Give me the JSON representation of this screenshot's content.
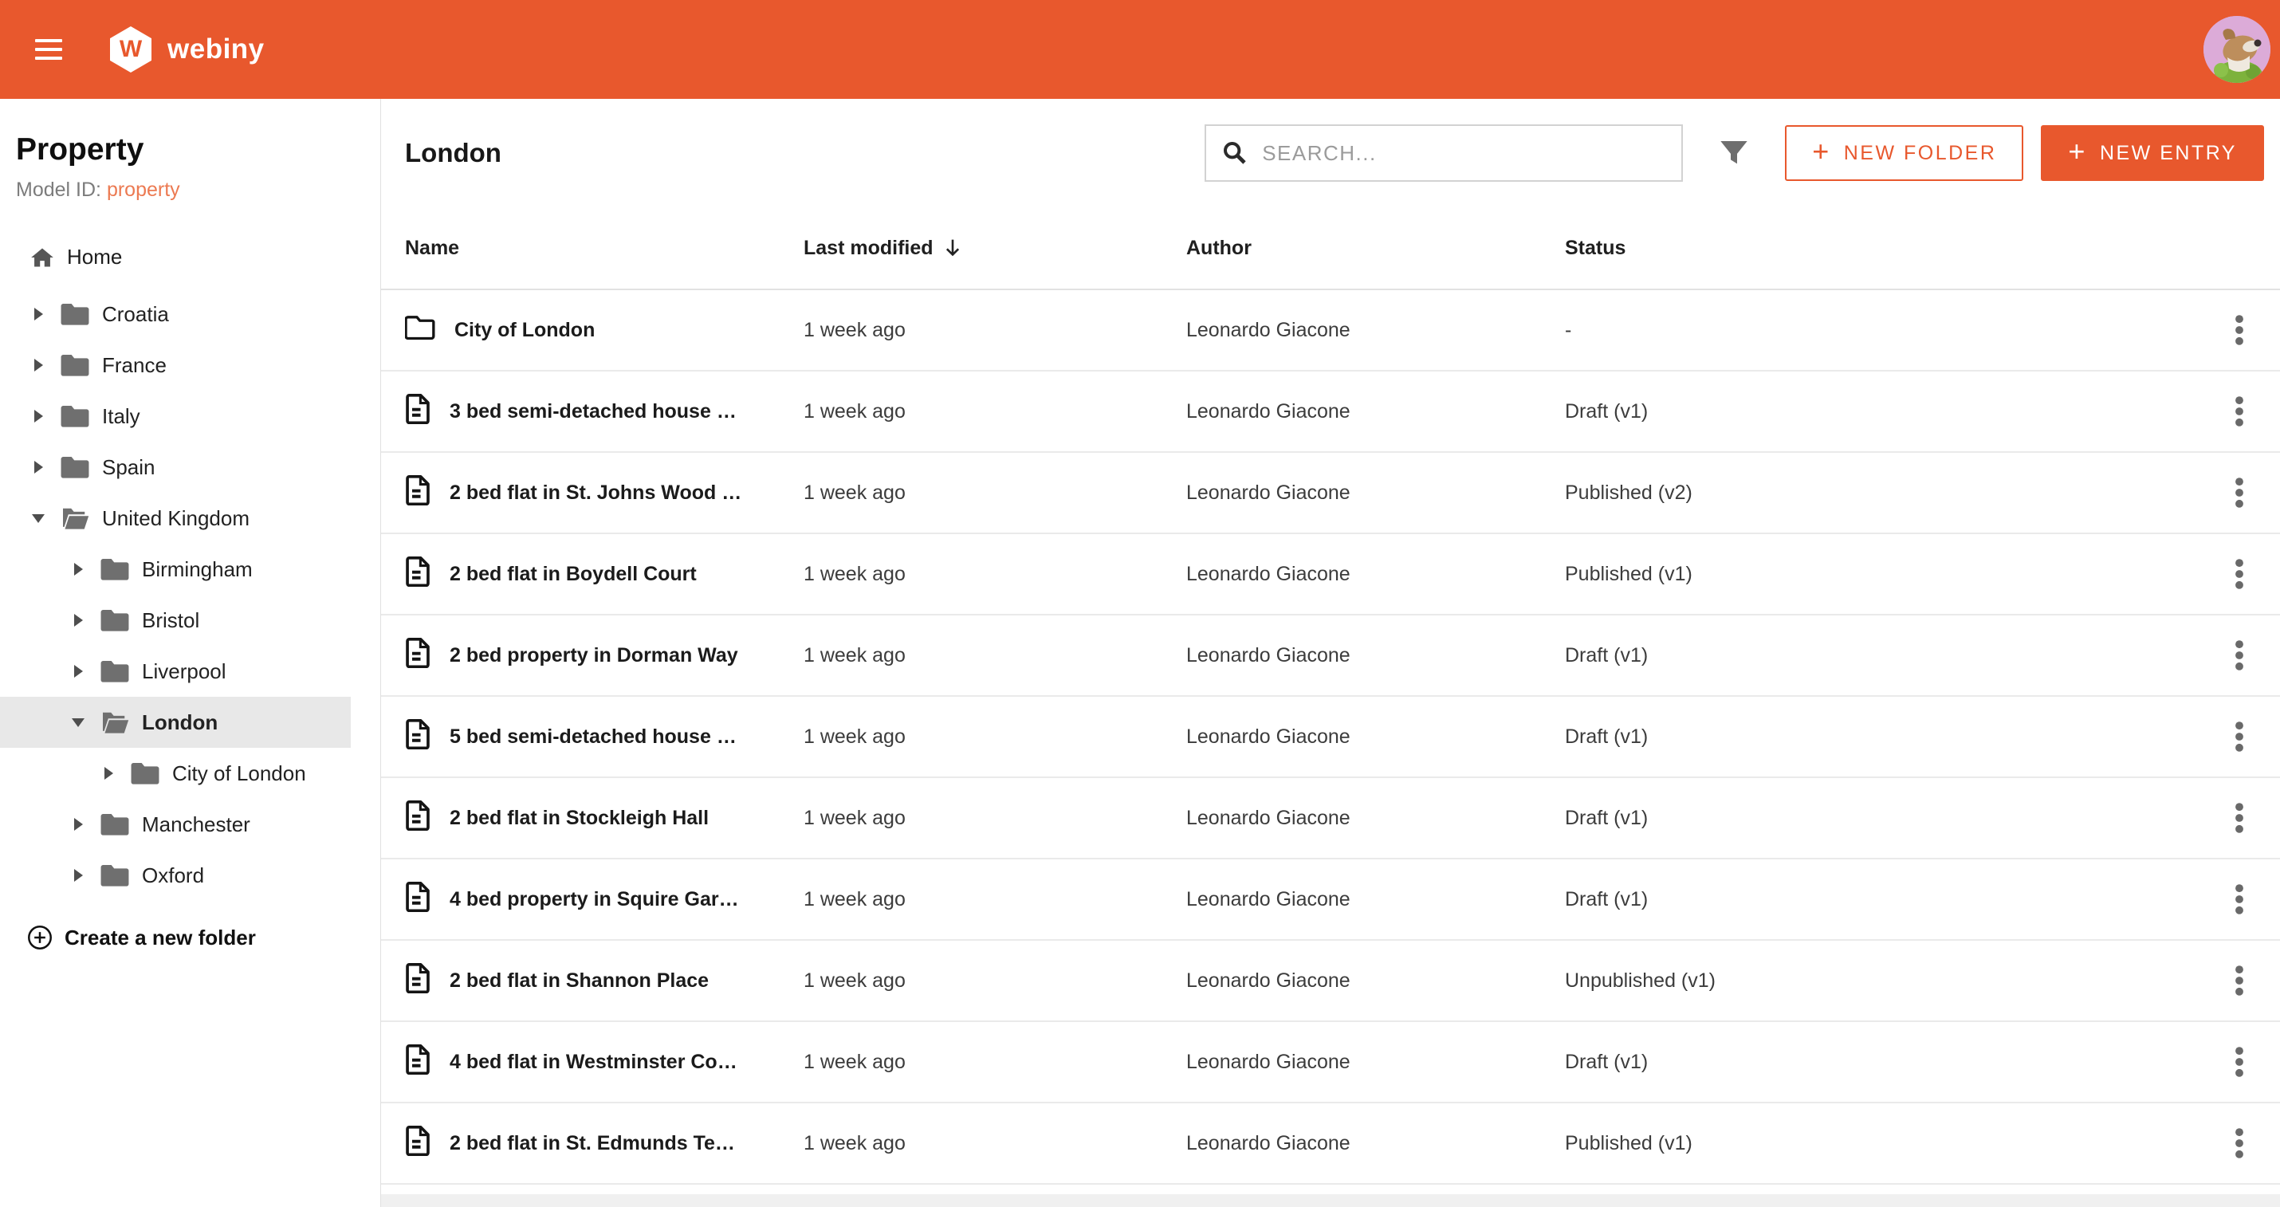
{
  "header": {
    "brand": "webiny",
    "logo_letter": "W"
  },
  "sidebar": {
    "title": "Property",
    "model_id_label": "Model ID:",
    "model_id_value": "property",
    "home_label": "Home",
    "create_folder_label": "Create a new folder",
    "tree": [
      {
        "label": "Croatia",
        "level": 1,
        "state": "collapsed",
        "selected": false
      },
      {
        "label": "France",
        "level": 1,
        "state": "collapsed",
        "selected": false
      },
      {
        "label": "Italy",
        "level": 1,
        "state": "collapsed",
        "selected": false
      },
      {
        "label": "Spain",
        "level": 1,
        "state": "collapsed",
        "selected": false
      },
      {
        "label": "United Kingdom",
        "level": 1,
        "state": "expanded",
        "selected": false
      },
      {
        "label": "Birmingham",
        "level": 2,
        "state": "collapsed",
        "selected": false
      },
      {
        "label": "Bristol",
        "level": 2,
        "state": "collapsed",
        "selected": false
      },
      {
        "label": "Liverpool",
        "level": 2,
        "state": "collapsed",
        "selected": false
      },
      {
        "label": "London",
        "level": 2,
        "state": "expanded",
        "selected": true
      },
      {
        "label": "City of London",
        "level": 3,
        "state": "collapsed",
        "selected": false
      },
      {
        "label": "Manchester",
        "level": 2,
        "state": "collapsed",
        "selected": false
      },
      {
        "label": "Oxford",
        "level": 2,
        "state": "collapsed",
        "selected": false
      }
    ]
  },
  "main": {
    "title": "London",
    "search_placeholder": "SEARCH...",
    "new_folder_label": "NEW FOLDER",
    "new_entry_label": "NEW ENTRY",
    "table": {
      "columns": [
        "Name",
        "Last modified",
        "Author",
        "Status"
      ],
      "sorted_column": "Last modified",
      "sort_direction": "desc",
      "rows": [
        {
          "type": "folder",
          "name": "City of London",
          "modified": "1 week ago",
          "author": "Leonardo Giacone",
          "status": "-"
        },
        {
          "type": "entry",
          "name": "3 bed semi-detached house …",
          "modified": "1 week ago",
          "author": "Leonardo Giacone",
          "status": "Draft (v1)"
        },
        {
          "type": "entry",
          "name": "2 bed flat in St. Johns Wood …",
          "modified": "1 week ago",
          "author": "Leonardo Giacone",
          "status": "Published (v2)"
        },
        {
          "type": "entry",
          "name": "2 bed flat in Boydell Court",
          "modified": "1 week ago",
          "author": "Leonardo Giacone",
          "status": "Published (v1)"
        },
        {
          "type": "entry",
          "name": "2 bed property in Dorman Way",
          "modified": "1 week ago",
          "author": "Leonardo Giacone",
          "status": "Draft (v1)"
        },
        {
          "type": "entry",
          "name": "5 bed semi-detached house …",
          "modified": "1 week ago",
          "author": "Leonardo Giacone",
          "status": "Draft (v1)"
        },
        {
          "type": "entry",
          "name": "2 bed flat in Stockleigh Hall",
          "modified": "1 week ago",
          "author": "Leonardo Giacone",
          "status": "Draft (v1)"
        },
        {
          "type": "entry",
          "name": "4 bed property in Squire Gar…",
          "modified": "1 week ago",
          "author": "Leonardo Giacone",
          "status": "Draft (v1)"
        },
        {
          "type": "entry",
          "name": "2 bed flat in Shannon Place",
          "modified": "1 week ago",
          "author": "Leonardo Giacone",
          "status": "Unpublished (v1)"
        },
        {
          "type": "entry",
          "name": "4 bed flat in Westminster Co…",
          "modified": "1 week ago",
          "author": "Leonardo Giacone",
          "status": "Draft (v1)"
        },
        {
          "type": "entry",
          "name": "2 bed flat in St. Edmunds Te…",
          "modified": "1 week ago",
          "author": "Leonardo Giacone",
          "status": "Published (v1)"
        }
      ]
    }
  },
  "colors": {
    "accent_orange": "#e8582d",
    "model_id_link": "#ec7a52",
    "selected_row_bg": "#e8e8e8"
  }
}
